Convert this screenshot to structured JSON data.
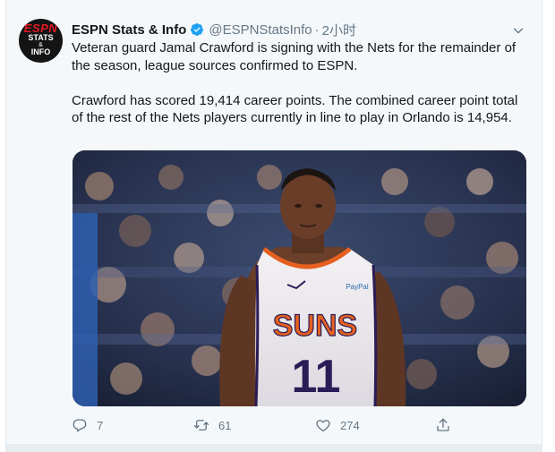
{
  "tweet": {
    "avatar_text": {
      "brand": "ESPN",
      "line1": "STATS",
      "amp": "&",
      "line2": "INFO"
    },
    "display_name": "ESPN Stats & Info",
    "handle": "@ESPNStatsInfo",
    "separator": "·",
    "time": "2小时",
    "paragraph1": "Veteran guard Jamal Crawford is signing with the Nets for the remainder of the season, league sources confirmed to ESPN.",
    "paragraph2": "Crawford has scored 19,414 career points. The combined career point total of the rest of the Nets players currently in line to play in Orlando is 14,954.",
    "jersey_text": "SUNS",
    "jersey_number": "11",
    "jersey_sponsor": "PayPal",
    "actions": {
      "reply_count": "7",
      "retweet_count": "61",
      "like_count": "274"
    }
  },
  "colors": {
    "verified_blue": "#1da1f2",
    "secondary_text": "#657786",
    "suns_orange": "#e56020",
    "suns_purple": "#2b1b56"
  }
}
